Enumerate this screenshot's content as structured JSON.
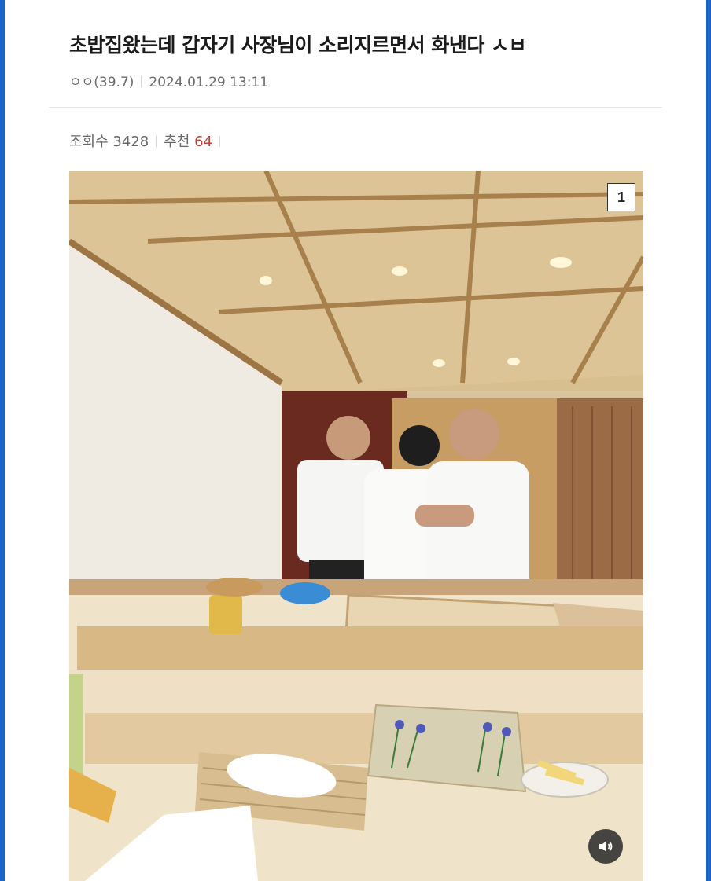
{
  "post": {
    "title": "초밥집왔는데 갑자기 사장님이 소리지르면서 화낸다 ㅅㅂ",
    "author": "ㅇㅇ(39.7)",
    "datetime": "2024.01.29 13:11"
  },
  "stats": {
    "views_label": "조회수",
    "views_value": "3428",
    "recommend_label": "추천",
    "recommend_value": "64"
  },
  "image": {
    "index_label": "1",
    "sound_icon": "speaker-icon"
  },
  "colors": {
    "outer_border": "#1a66c8",
    "recommend_accent": "#b8433a"
  }
}
